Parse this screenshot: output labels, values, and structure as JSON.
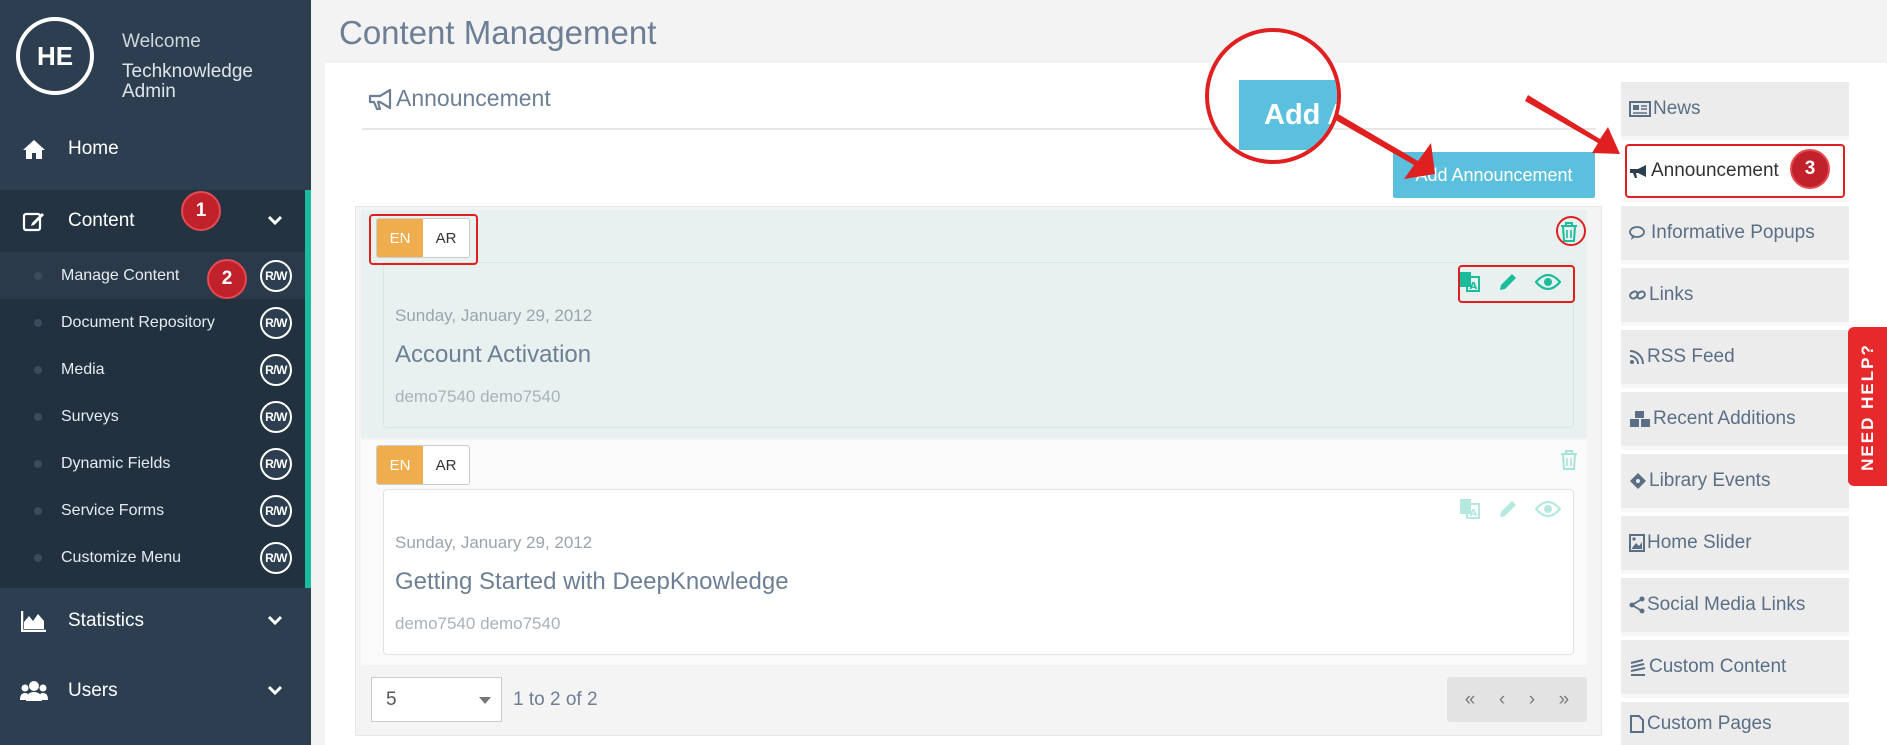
{
  "sidebar": {
    "avatar_initials": "HE",
    "welcome": "Welcome",
    "user_name": "Techknowledge Admin",
    "nav": {
      "home": "Home",
      "content": "Content",
      "statistics": "Statistics",
      "users": "Users"
    },
    "content_items": [
      {
        "label": "Manage Content",
        "badge": "R/W"
      },
      {
        "label": "Document Repository",
        "badge": "R/W"
      },
      {
        "label": "Media",
        "badge": "R/W"
      },
      {
        "label": "Surveys",
        "badge": "R/W"
      },
      {
        "label": "Dynamic Fields",
        "badge": "R/W"
      },
      {
        "label": "Service Forms",
        "badge": "R/W"
      },
      {
        "label": "Customize Menu",
        "badge": "R/W"
      }
    ]
  },
  "steps": [
    "1",
    "2",
    "3"
  ],
  "main": {
    "page_title": "Content Management",
    "section_title": "Announcement",
    "add_button": "Add Announcement",
    "zoom_button_text": "Add A",
    "items": [
      {
        "lang_en": "EN",
        "lang_ar": "AR",
        "date": "Sunday, January 29, 2012",
        "title": "Account Activation",
        "author": "demo7540 demo7540"
      },
      {
        "lang_en": "EN",
        "lang_ar": "AR",
        "date": "Sunday, January 29, 2012",
        "title": "Getting Started with DeepKnowledge",
        "author": "demo7540 demo7540"
      }
    ],
    "pagination": {
      "page_size": "5",
      "info": "1 to 2 of 2",
      "first": "«",
      "prev": "‹",
      "next": "›",
      "last": "»"
    }
  },
  "right_menu": [
    {
      "label": "News",
      "icon": "newspaper-icon"
    },
    {
      "label": "Announcement",
      "icon": "bullhorn-icon"
    },
    {
      "label": "Informative Popups",
      "icon": "comments-icon"
    },
    {
      "label": "Links",
      "icon": "link-icon"
    },
    {
      "label": "RSS Feed",
      "icon": "rss-icon"
    },
    {
      "label": "Recent Additions",
      "icon": "cubes-icon"
    },
    {
      "label": "Library Events",
      "icon": "ticket-icon"
    },
    {
      "label": "Home Slider",
      "icon": "image-icon"
    },
    {
      "label": "Social Media Links",
      "icon": "share-icon"
    },
    {
      "label": "Custom Content",
      "icon": "stack-icon"
    },
    {
      "label": "Custom Pages",
      "icon": "file-icon"
    }
  ],
  "need_help": "NEED HELP?",
  "colors": {
    "sidebar_bg": "#2c3e50",
    "accent_green": "#1abc9c",
    "button_blue": "#5bc0de",
    "lang_active": "#f0ad4e",
    "annotation_red": "#e02020"
  }
}
